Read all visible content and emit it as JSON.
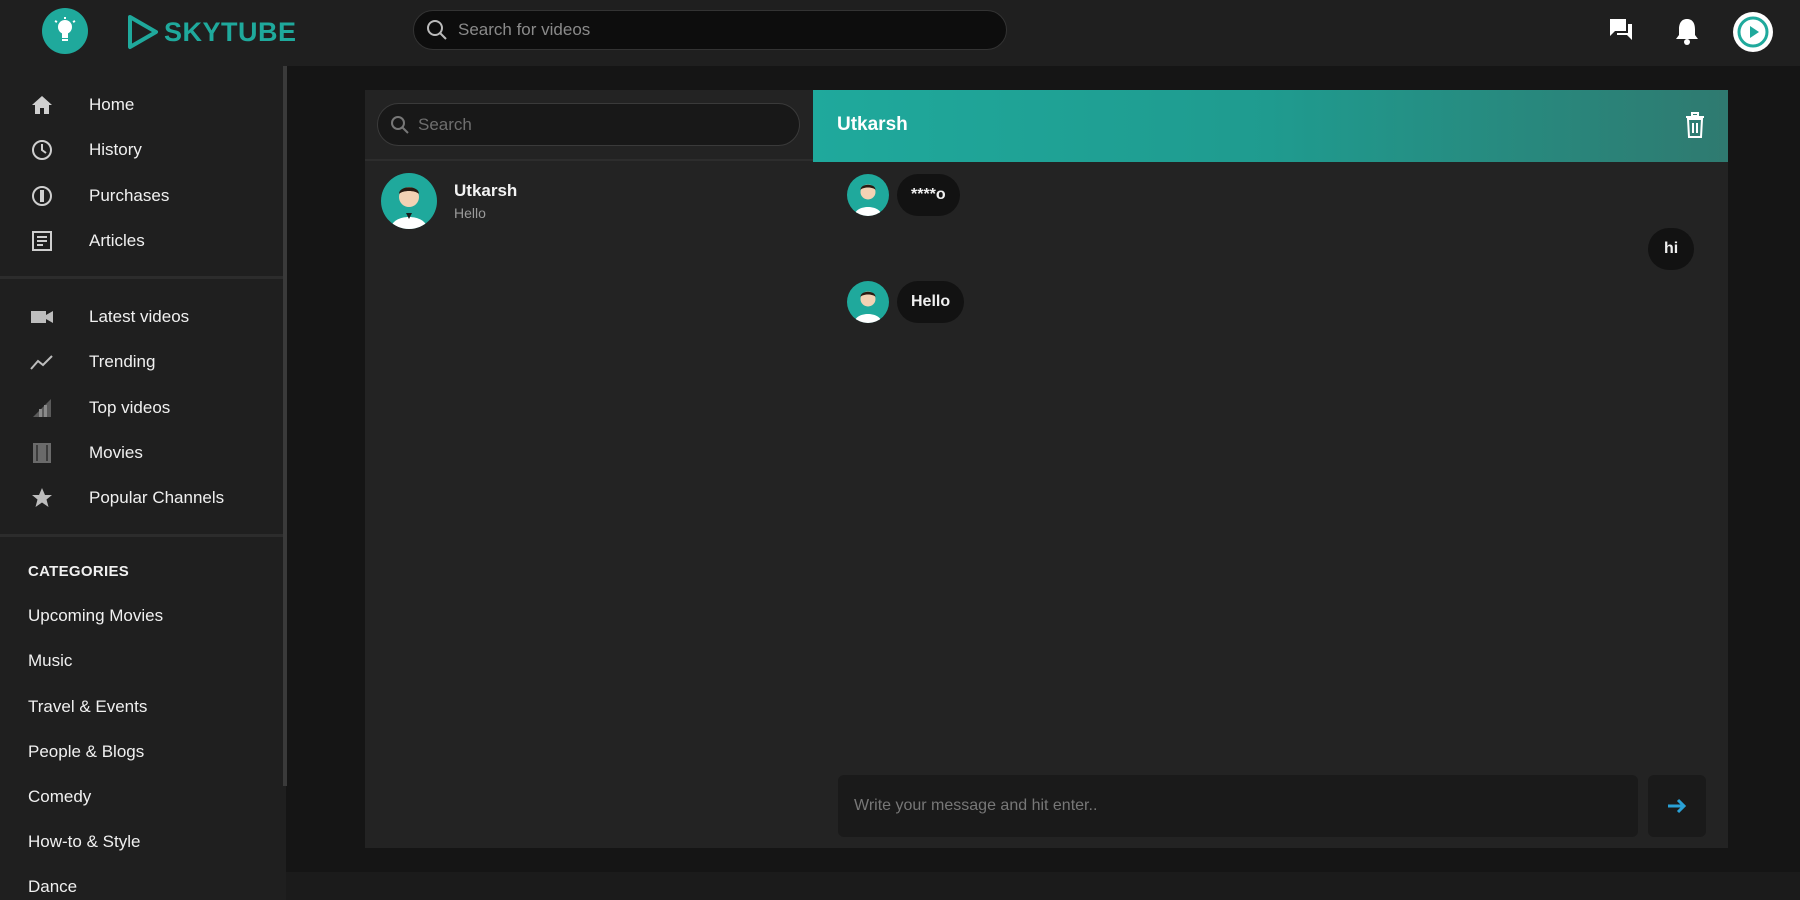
{
  "header": {
    "brand_name": "SKYTUBE",
    "search_placeholder": "Search for videos",
    "icons": [
      "bulb-icon",
      "play-logo-icon",
      "search-icon",
      "messages-icon",
      "bell-icon",
      "avatar-play-icon"
    ]
  },
  "sidebar": {
    "main": [
      {
        "label": "Home",
        "icon": "home-icon"
      },
      {
        "label": "History",
        "icon": "clock-icon"
      },
      {
        "label": "Purchases",
        "icon": "dollar-circle-icon"
      },
      {
        "label": "Articles",
        "icon": "article-icon"
      }
    ],
    "videos": [
      {
        "label": "Latest videos",
        "icon": "video-camera-icon"
      },
      {
        "label": "Trending",
        "icon": "trending-line-icon"
      },
      {
        "label": "Top videos",
        "icon": "bar-signal-icon"
      },
      {
        "label": "Movies",
        "icon": "film-icon"
      },
      {
        "label": "Popular Channels",
        "icon": "star-icon"
      }
    ],
    "categories_heading": "CATEGORIES",
    "categories": [
      "Upcoming Movies",
      "Music",
      "Travel & Events",
      "People & Blogs",
      "Comedy",
      "How-to & Style",
      "Dance"
    ]
  },
  "conversations": {
    "search_placeholder": "Search",
    "items": [
      {
        "name": "Utkarsh",
        "preview": "Hello"
      }
    ]
  },
  "chat": {
    "title": "Utkarsh",
    "messages": [
      {
        "from": "other",
        "text": "****o"
      },
      {
        "from": "me",
        "text": "hi"
      },
      {
        "from": "other",
        "text": "Hello"
      }
    ],
    "compose_placeholder": "Write your message and hit enter..",
    "send_icon": "arrow-right-icon",
    "delete_icon": "trash-icon"
  },
  "colors": {
    "accent": "#1fa99c",
    "background": "#151515",
    "panel": "#232323",
    "bubble": "#121212"
  }
}
